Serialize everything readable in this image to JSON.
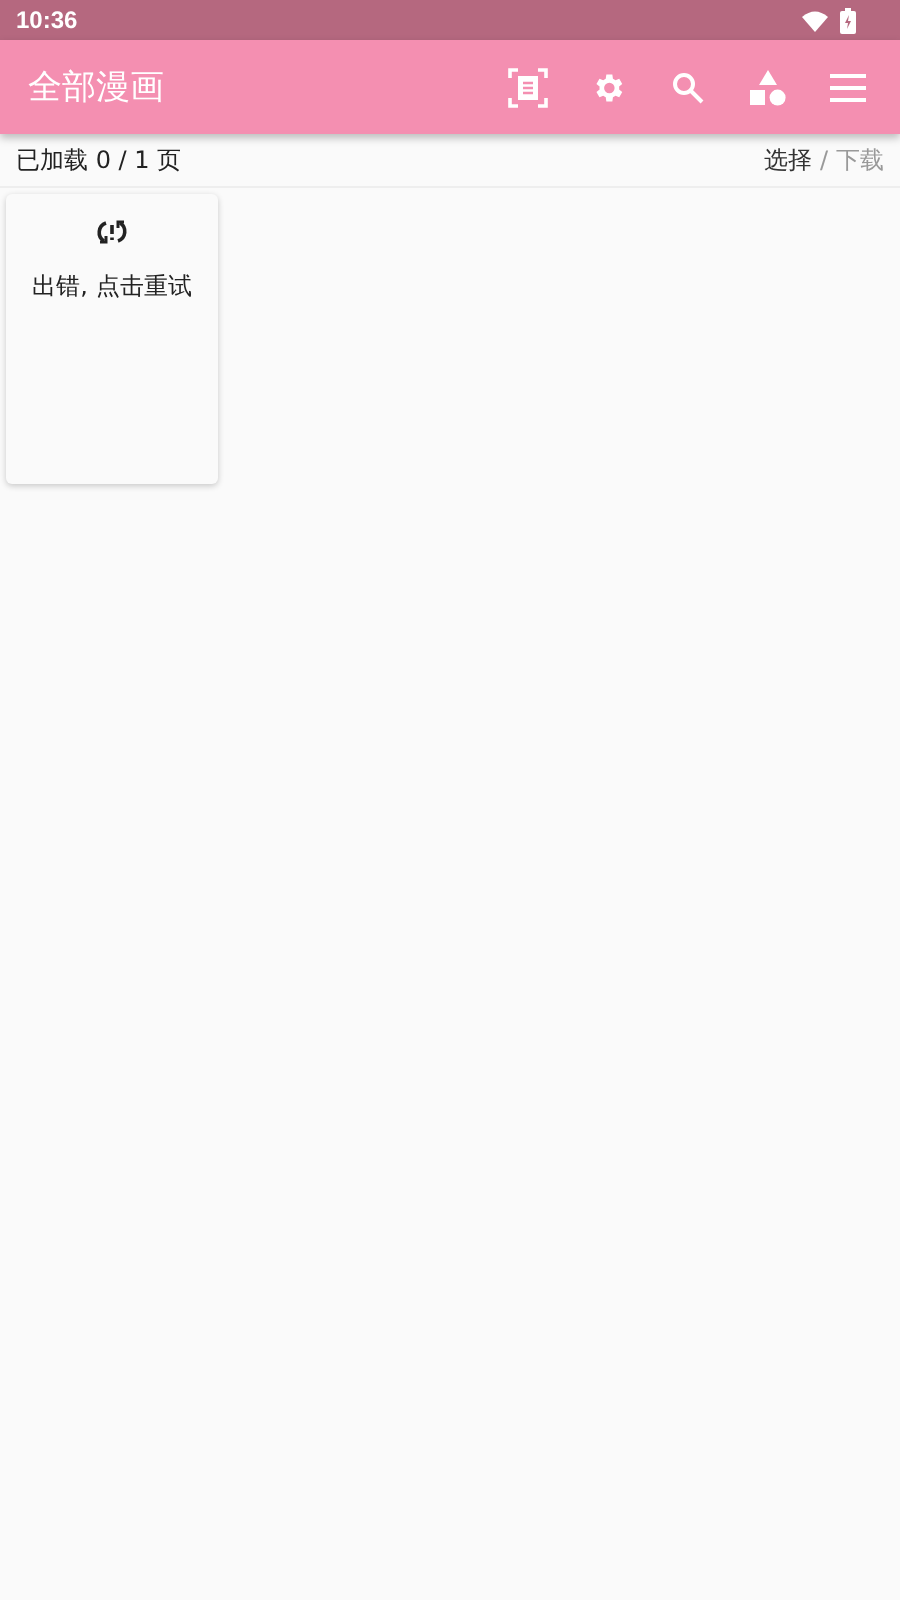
{
  "status_bar": {
    "time": "10:36"
  },
  "app_bar": {
    "title": "全部漫画"
  },
  "info_bar": {
    "loaded": "已加载 0 / 1 页",
    "modes": [
      {
        "label": "选择",
        "selected": true
      },
      {
        "label": "下载",
        "selected": false
      }
    ],
    "separator": "/"
  },
  "cards": [
    {
      "message": "出错, 点击重试"
    }
  ]
}
